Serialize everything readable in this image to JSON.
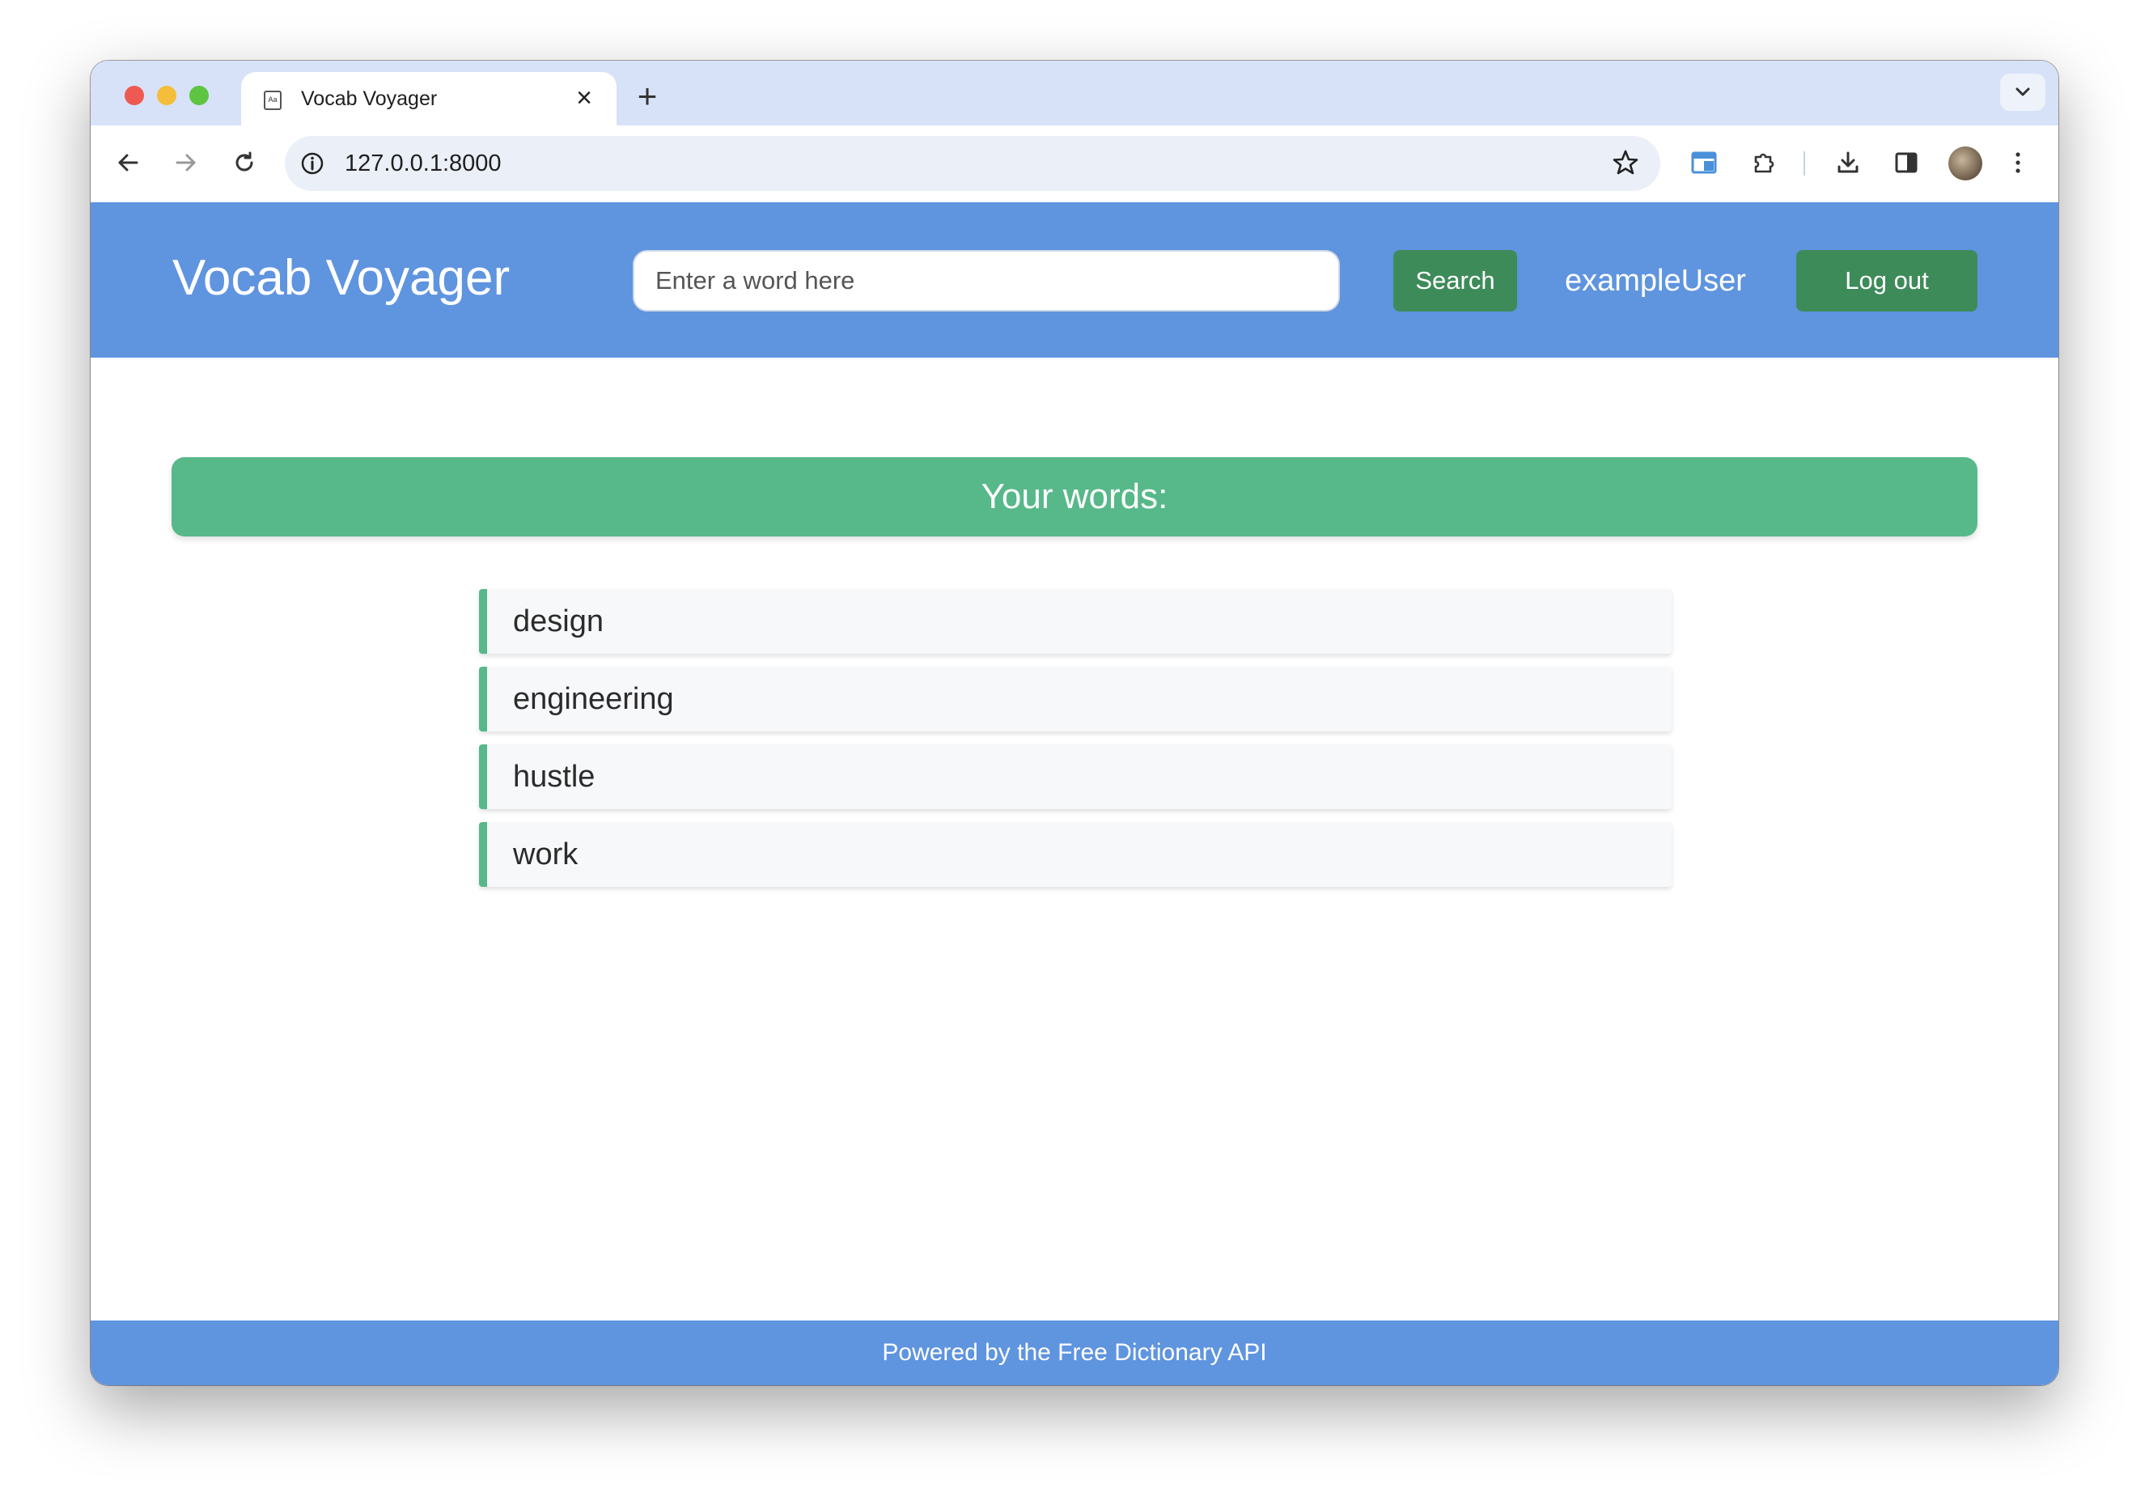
{
  "browser": {
    "tab_title": "Vocab Voyager",
    "favicon_text": "Aa",
    "url": "127.0.0.1:8000"
  },
  "header": {
    "brand": "Vocab Voyager",
    "search_placeholder": "Enter a word here",
    "search_button": "Search",
    "username": "exampleUser",
    "logout_button": "Log out"
  },
  "main": {
    "banner": "Your words:",
    "words": [
      "design",
      "engineering",
      "hustle",
      "work"
    ]
  },
  "footer": {
    "text": "Powered by the Free Dictionary API"
  },
  "colors": {
    "header_bg": "#5f94df",
    "accent_green": "#57b889",
    "button_green": "#3e8b5a",
    "tabstrip_bg": "#d7e2f8"
  }
}
